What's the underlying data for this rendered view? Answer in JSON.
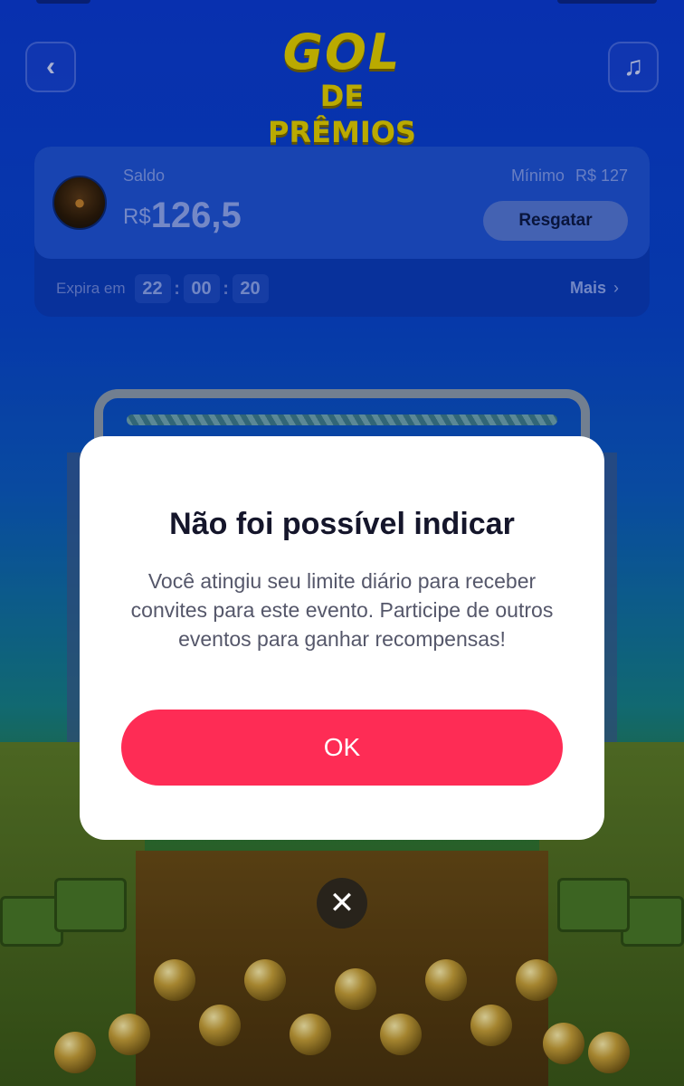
{
  "header": {
    "back_icon": "chevron-left-icon",
    "music_icon": "music-note-icon",
    "logo_line1": "GOL",
    "logo_line2": "DE PRÊMIOS"
  },
  "balance": {
    "label": "Saldo",
    "currency": "R$",
    "amount": "126,5",
    "minimum_label": "Mínimo",
    "minimum_value": "R$ 127",
    "redeem_label": "Resgatar"
  },
  "expiry": {
    "label": "Expira em",
    "hours": "22",
    "minutes": "00",
    "seconds": "20",
    "more_label": "Mais",
    "more_icon": "chevron-right-icon"
  },
  "modal": {
    "title": "Não foi possível indicar",
    "body": "Você atingiu seu limite diário para receber convites para este evento. Participe de outros eventos para ganhar recompensas!",
    "ok_label": "OK",
    "close_icon": "close-icon"
  },
  "colors": {
    "primary_button": "#fe2c55",
    "background_blue": "#0a3bd6",
    "logo_yellow": "#e3d000"
  }
}
